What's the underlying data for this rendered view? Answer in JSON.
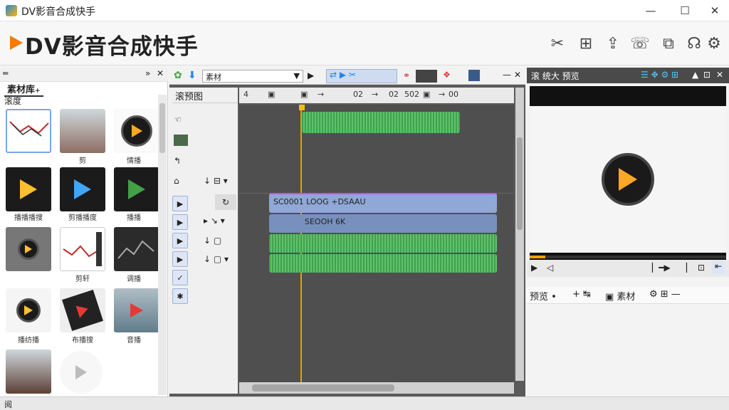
{
  "window": {
    "title": "DV影音合成快手",
    "minimize": "—",
    "maximize": "☐",
    "close": "✕"
  },
  "header": {
    "app_title": "DV影音合成快手"
  },
  "left_panel": {
    "menu_icon": "═",
    "tab_label": "素材库",
    "tab_plus": "+",
    "sub_label": "滚度",
    "items": [
      {
        "label": ""
      },
      {
        "label": "剪"
      },
      {
        "label": "情播"
      },
      {
        "label": "播播播搜"
      },
      {
        "label": "剪播播度"
      },
      {
        "label": "播播"
      },
      {
        "label": ""
      },
      {
        "label": "剪轩"
      },
      {
        "label": "调播"
      },
      {
        "label": "播纺播"
      },
      {
        "label": "布播搜"
      },
      {
        "label": "音播"
      },
      {
        "label": ""
      },
      {
        "label": ""
      }
    ]
  },
  "center_panel": {
    "dropdown_value": "素材",
    "timeline_title": "滚预图",
    "ruler_labels": [
      "4",
      "→",
      "02",
      "→",
      "02",
      "502",
      "→",
      "00"
    ],
    "track1_label": "SC0001 LOOG +DSAAU",
    "track2_label": "SEOOH 6K"
  },
  "right_panel": {
    "title": "滚 统大 预览",
    "tab_preview": "预览",
    "tab_material": "素材",
    "progress": 0.08
  },
  "status": {
    "text": "阅"
  },
  "colors": {
    "accent": "#f57c00",
    "blue": "#1e88e5",
    "green": "#3fa34d",
    "track_blue": "#8fa8d6"
  }
}
